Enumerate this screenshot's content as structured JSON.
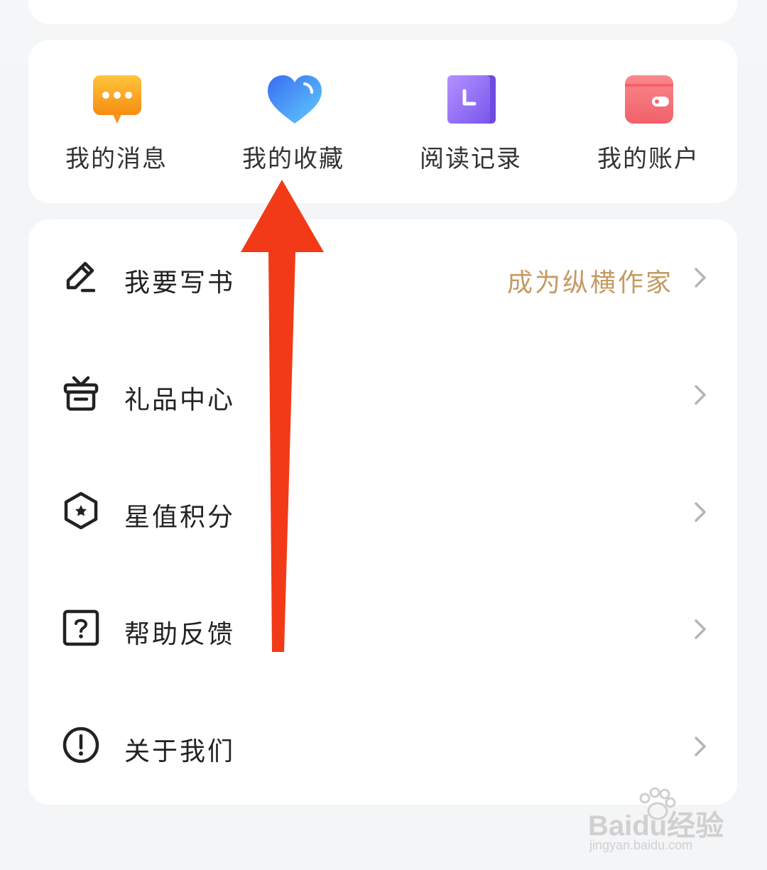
{
  "quick_actions": [
    {
      "label": "我的消息",
      "icon": "message-icon",
      "color": "#f7a51c"
    },
    {
      "label": "我的收藏",
      "icon": "heart-icon",
      "color": "#4a8ff6"
    },
    {
      "label": "阅读记录",
      "icon": "clock-icon",
      "color": "#8b68f0"
    },
    {
      "label": "我的账户",
      "icon": "wallet-icon",
      "color": "#f26a6a"
    }
  ],
  "menu": [
    {
      "label": "我要写书",
      "icon": "pen-icon",
      "extra": "成为纵横作家"
    },
    {
      "label": "礼品中心",
      "icon": "gift-icon"
    },
    {
      "label": "星值积分",
      "icon": "star-hexagon-icon"
    },
    {
      "label": "帮助反馈",
      "icon": "help-icon"
    },
    {
      "label": "关于我们",
      "icon": "info-icon"
    }
  ],
  "colors": {
    "background": "#f4f5f7",
    "card": "#ffffff",
    "accent_gold": "#c59a63",
    "annotation_arrow": "#f23a18"
  },
  "watermark": {
    "brand": "Baidu经验",
    "url": "jingyan.baidu.com"
  }
}
